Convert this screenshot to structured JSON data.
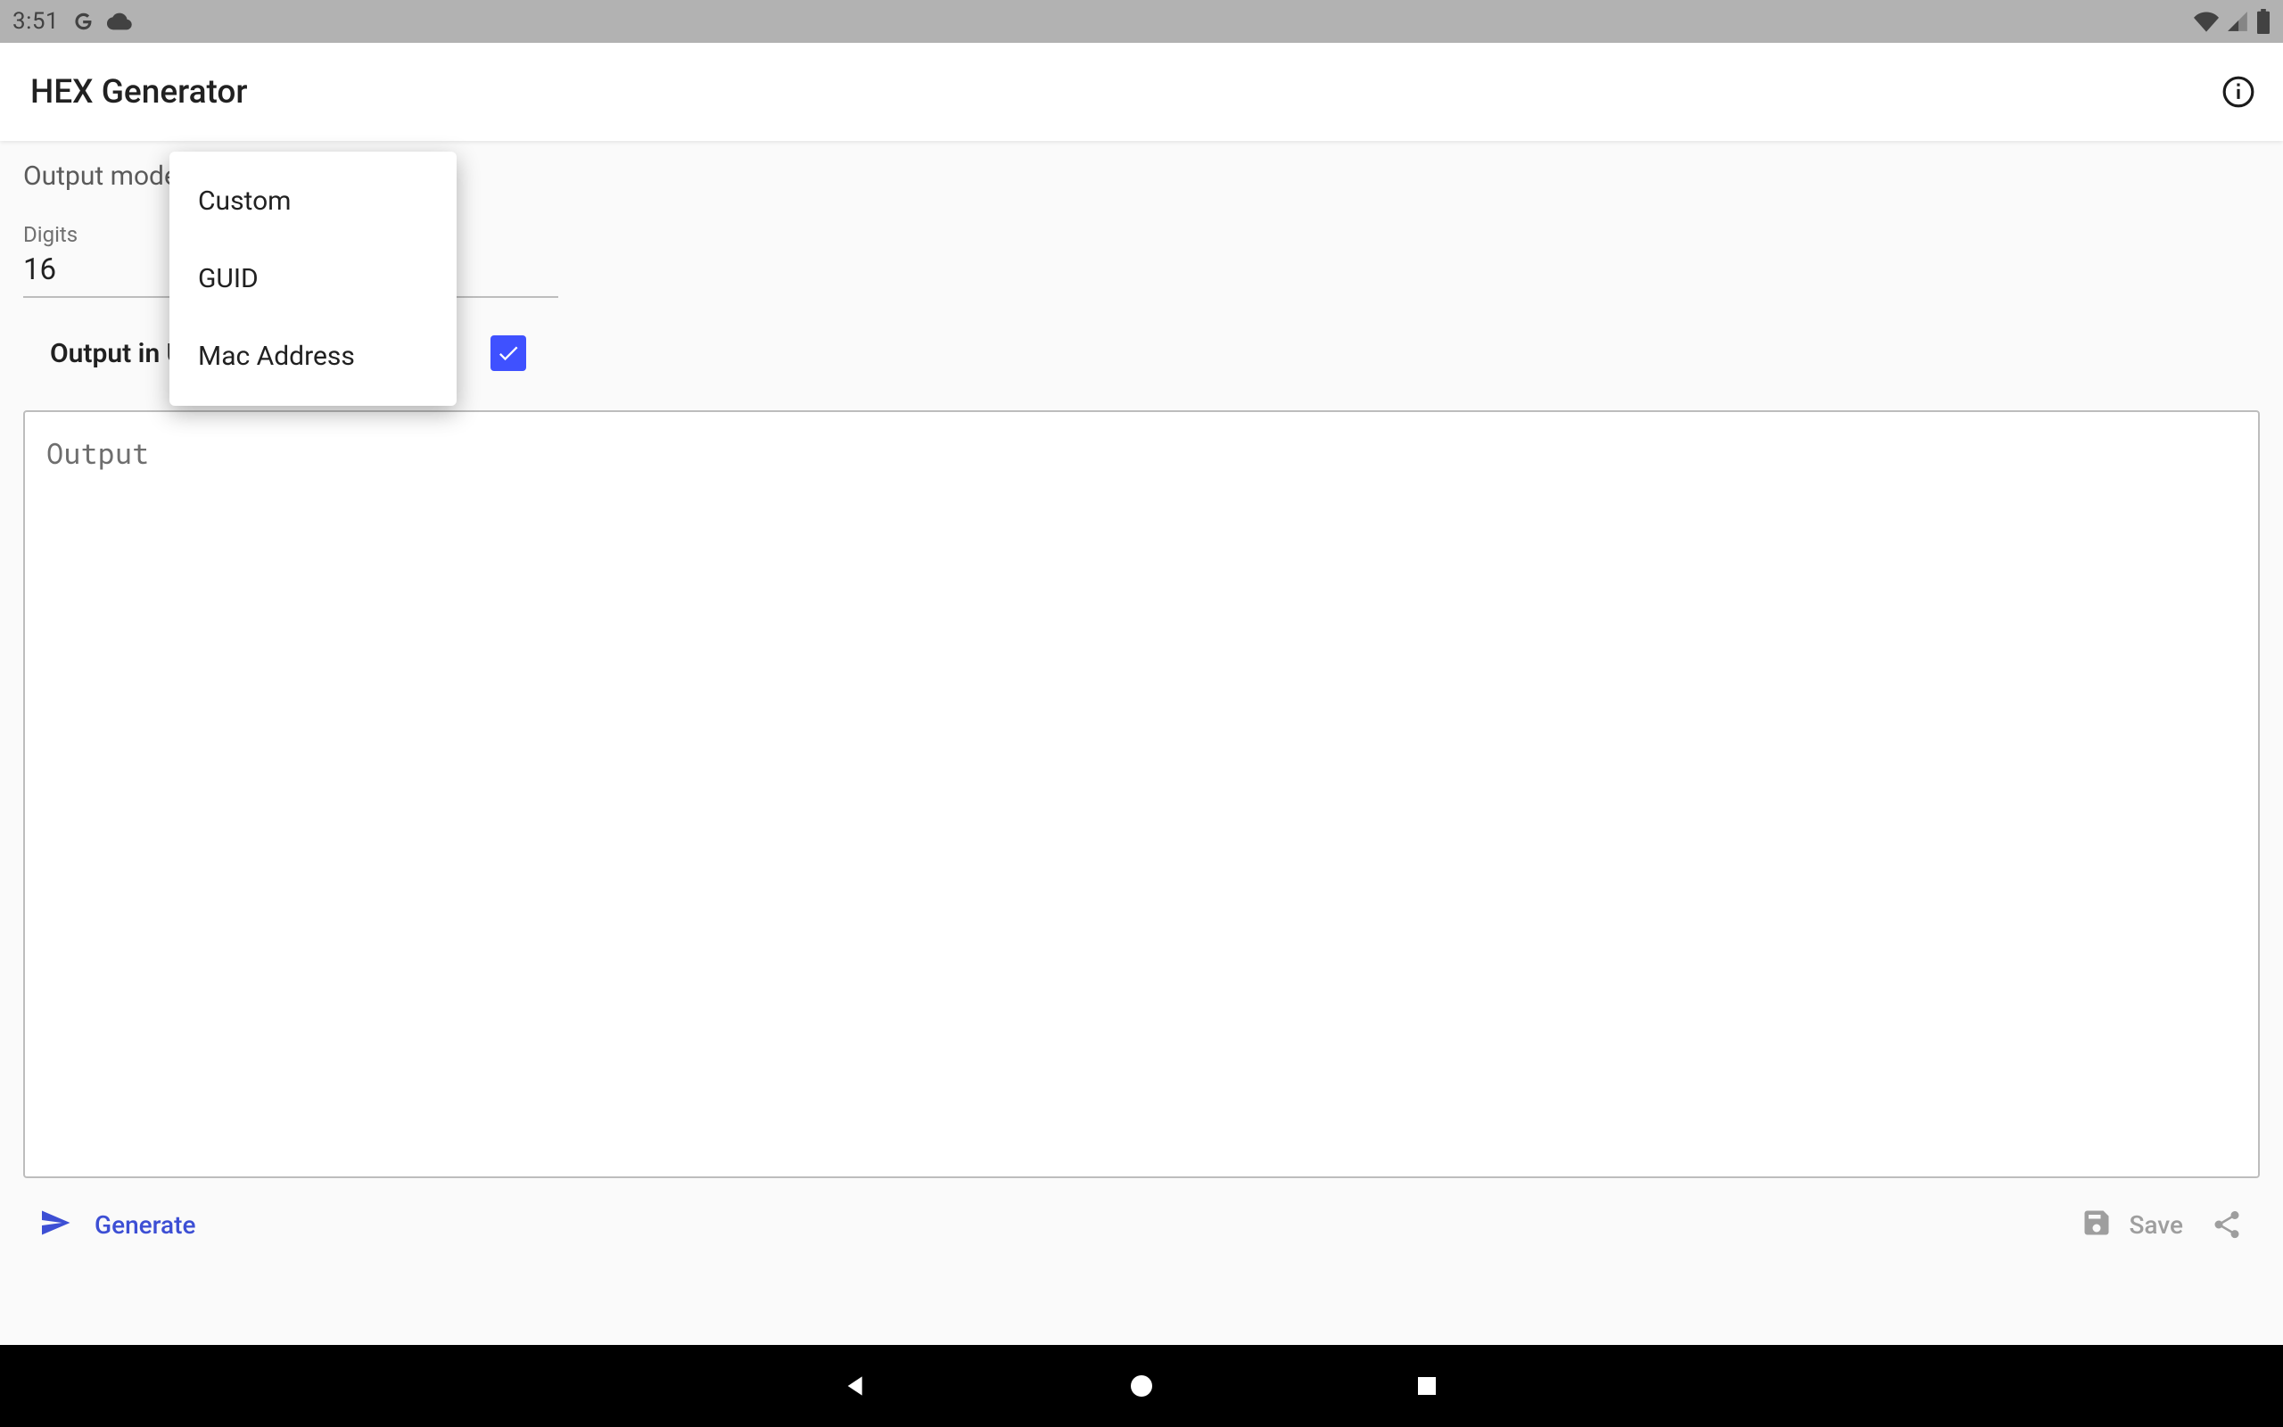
{
  "status": {
    "time": "3:51"
  },
  "appbar": {
    "title": "HEX Generator"
  },
  "form": {
    "mode_caption": "Output mode",
    "digits_caption": "Digits",
    "digits_value": "16",
    "uppercase_label": "Output in Uppercase",
    "uppercase_checked": true,
    "output_placeholder": "Output"
  },
  "menu": {
    "items": [
      "Custom",
      "GUID",
      "Mac Address"
    ]
  },
  "actions": {
    "generate": "Generate",
    "save": "Save"
  }
}
